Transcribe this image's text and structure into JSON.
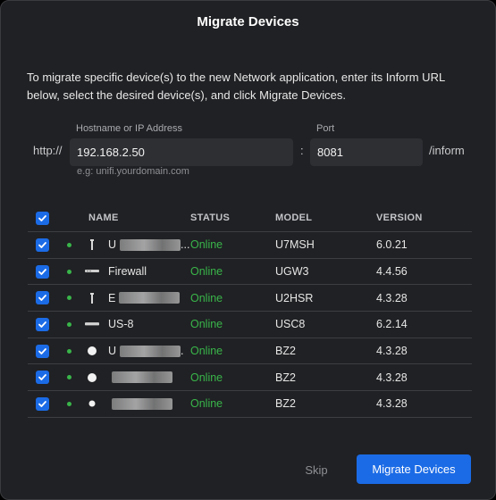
{
  "dialog": {
    "title": "Migrate Devices",
    "description": "To migrate specific device(s) to the new Network application, enter its Inform URL below, select the desired device(s), and click Migrate Devices."
  },
  "form": {
    "protocol": "http://",
    "host_label": "Hostname or IP Address",
    "host_value": "192.168.2.50",
    "host_hint": "e.g: unifi.yourdomain.com",
    "separator": ":",
    "port_label": "Port",
    "port_value": "8081",
    "suffix": "/inform"
  },
  "table": {
    "columns": [
      "NAME",
      "STATUS",
      "MODEL",
      "VERSION"
    ],
    "status_color": "#39b54a",
    "accent_color": "#1b6be6",
    "rows": [
      {
        "name": "U",
        "name_redacted": true,
        "name_tail": "...",
        "icon": "ap-antenna-icon",
        "status": "Online",
        "model": "U7MSH",
        "version": "6.0.21"
      },
      {
        "name": "Firewall",
        "name_redacted": false,
        "name_tail": "",
        "icon": "gateway-icon",
        "status": "Online",
        "model": "UGW3",
        "version": "4.4.56"
      },
      {
        "name": "E",
        "name_redacted": true,
        "name_tail": "",
        "icon": "ap-antenna-icon",
        "status": "Online",
        "model": "U2HSR",
        "version": "4.3.28"
      },
      {
        "name": "US-8",
        "name_redacted": false,
        "name_tail": "",
        "icon": "switch-icon",
        "status": "Online",
        "model": "USC8",
        "version": "6.2.14"
      },
      {
        "name": "U",
        "name_redacted": true,
        "name_tail": ".",
        "icon": "puck-ap-icon",
        "status": "Online",
        "model": "BZ2",
        "version": "4.3.28"
      },
      {
        "name": "",
        "name_redacted": true,
        "name_tail": "",
        "icon": "puck-ap-icon",
        "status": "Online",
        "model": "BZ2",
        "version": "4.3.28"
      },
      {
        "name": "",
        "name_redacted": true,
        "name_tail": "",
        "icon": "puck-ap-small-icon",
        "status": "Online",
        "model": "BZ2",
        "version": "4.3.28"
      }
    ]
  },
  "actions": {
    "skip_label": "Skip",
    "migrate_label": "Migrate Devices"
  }
}
